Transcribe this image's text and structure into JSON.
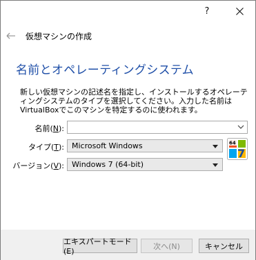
{
  "titlebar": {
    "help_label": "?",
    "close_icon": "close-icon"
  },
  "wizard": {
    "caption": "仮想マシンの作成",
    "back_icon": "back-arrow-icon"
  },
  "page": {
    "title": "名前とオペレーティングシステム",
    "description": "新しい仮想マシンの記述名を指定し、インストールするオペレーティングシステムのタイプを選択してください。入力した名前はVirtualBoxでこのマシンを特定するのに使われます。"
  },
  "form": {
    "name_label": "名前(",
    "name_accel": "N",
    "name_label_end": "):",
    "name_value": "",
    "type_label": "タイプ(",
    "type_accel": "T",
    "type_label_end": "):",
    "type_value": "Microsoft Windows",
    "version_label": "バージョン(",
    "version_accel": "V",
    "version_label_end": "):",
    "version_value": "Windows 7 (64-bit)",
    "os_icon": "windows7-64-icon",
    "os_badge_top": "64",
    "os_badge_num": "7"
  },
  "buttons": {
    "expert": "エキスパートモード(E)",
    "next": "次へ(N)",
    "cancel": "キャンセル"
  }
}
